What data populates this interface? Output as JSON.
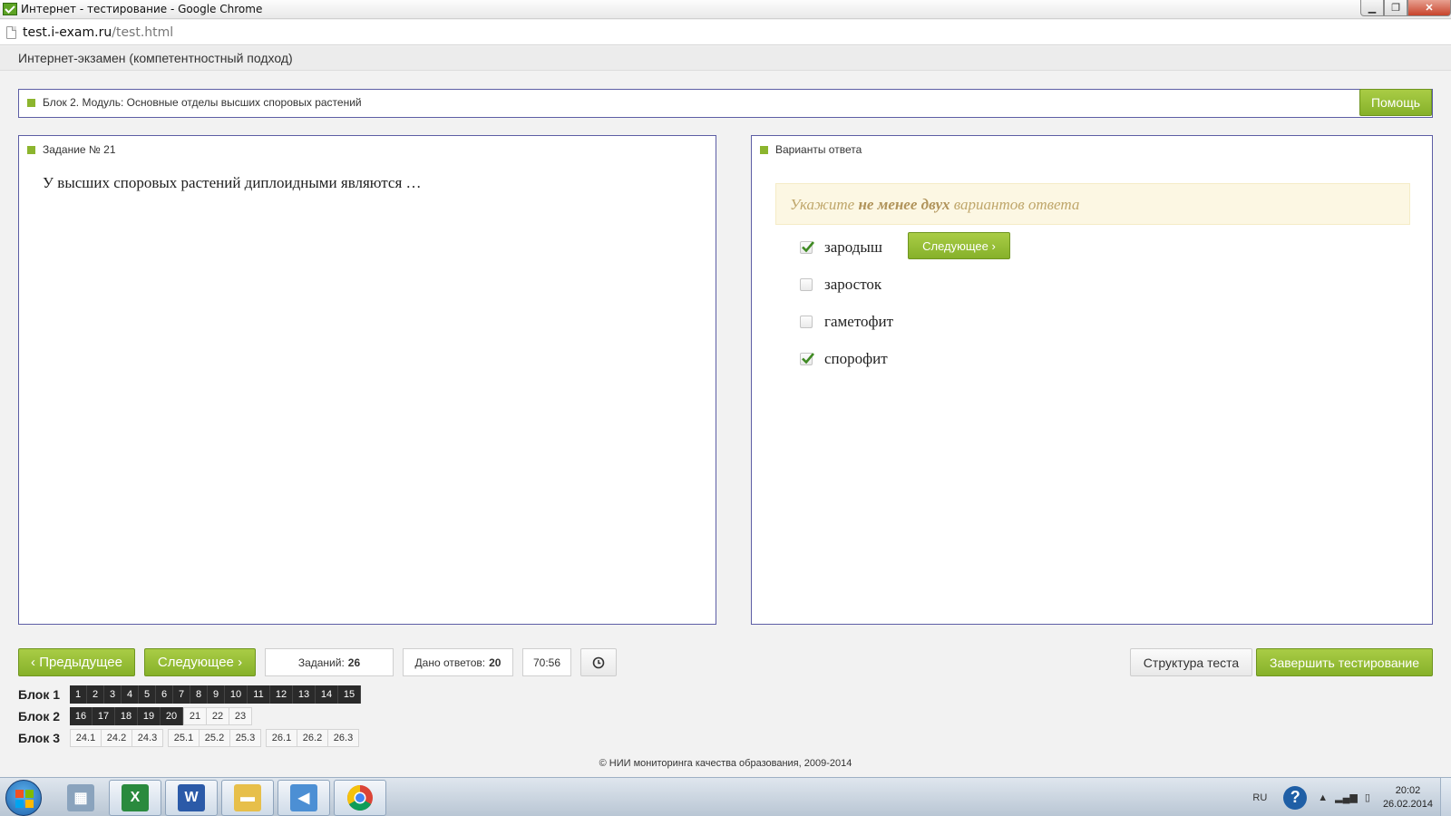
{
  "window": {
    "title": "Интернет - тестирование - Google Chrome"
  },
  "address": {
    "host": "test.i-exam.ru",
    "path": "/test.html"
  },
  "app": {
    "header": "Интернет-экзамен (компетентностный подход)",
    "help_label": "Помощь"
  },
  "block": {
    "label": "Блок 2. Модуль: Основные отделы высших споровых растений"
  },
  "task": {
    "title": "Задание № 21",
    "question": "У высших споровых растений диплоидными являются …"
  },
  "answers": {
    "title": "Варианты ответа",
    "hint_pre": "Укажите ",
    "hint_bold": "не менее двух",
    "hint_post": " вариантов ответа",
    "next_label": "Следующее",
    "options": [
      {
        "text": "зародыш",
        "checked": true
      },
      {
        "text": "заросток",
        "checked": false
      },
      {
        "text": "гаметофит",
        "checked": false
      },
      {
        "text": "спорофит",
        "checked": true
      }
    ]
  },
  "nav": {
    "prev_label": "Предыдущее",
    "next_label": "Следующее",
    "tasks_label": "Заданий:",
    "tasks_value": "26",
    "answered_label": "Дано ответов:",
    "answered_value": "20",
    "timer": "70:56",
    "structure_label": "Структура теста",
    "finish_label": "Завершить тестирование"
  },
  "blocks": [
    {
      "label": "Блок 1",
      "cells": [
        "1",
        "2",
        "3",
        "4",
        "5",
        "6",
        "7",
        "8",
        "9",
        "10",
        "11",
        "12",
        "13",
        "14",
        "15"
      ]
    },
    {
      "label": "Блок 2",
      "cells": [
        "16",
        "17",
        "18",
        "19",
        "20",
        "21",
        "22",
        "23"
      ]
    },
    {
      "label": "Блок 3",
      "cells": [
        "24.1",
        "24.2",
        "24.3",
        "25.1",
        "25.2",
        "25.3",
        "26.1",
        "26.2",
        "26.3"
      ]
    }
  ],
  "footer": "© НИИ мониторинга качества образования, 2009-2014",
  "taskbar": {
    "lang": "RU",
    "time": "20:02",
    "date": "26.02.2014",
    "apps": [
      "calculator-icon",
      "excel-icon",
      "word-icon",
      "explorer-icon",
      "volume-icon",
      "chrome-icon"
    ]
  },
  "colors": {
    "accent": "#8cb52e",
    "border": "#5d5ea5",
    "hint_bg": "#fcf7e3"
  }
}
